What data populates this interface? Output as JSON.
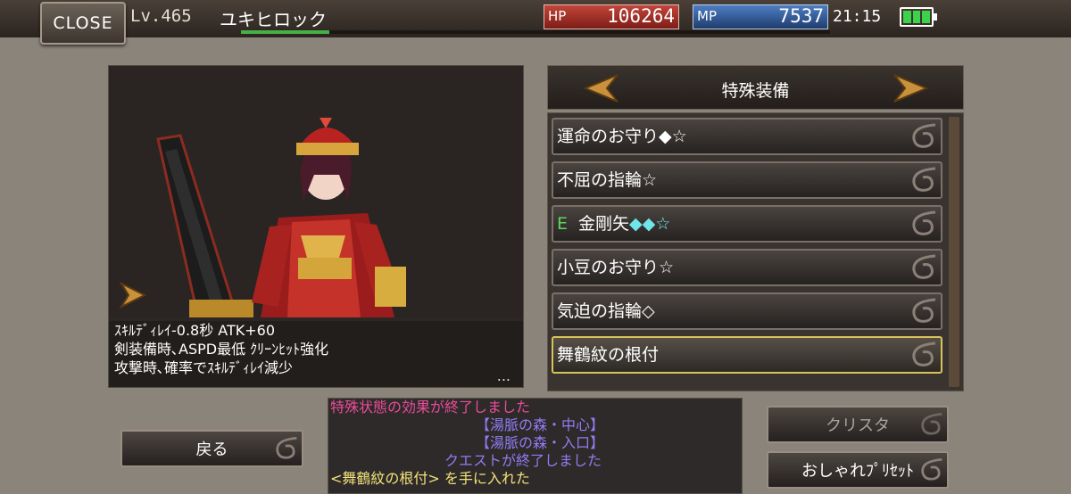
{
  "topbar": {
    "close_label": "CLOSE",
    "level": "Lv.465",
    "player_name": "ユキヒロック",
    "exp_fraction": 0.15,
    "hp_label": "HP",
    "hp_value": "106264",
    "mp_label": "MP",
    "mp_value": "7537",
    "clock": "21:15",
    "battery_level": 1.0
  },
  "character": {
    "desc_lines": [
      "ｽｷﾙﾃﾞｨﾚｲ-0.8秒 ATK+60",
      "剣装備時､ASPD最低 ｸﾘｰﾝﾋｯﾄ強化",
      "攻撃時､確率でｽｷﾙﾃﾞｨﾚｲ減少"
    ],
    "more": "..."
  },
  "equip": {
    "category": "特殊装備",
    "items": [
      {
        "equipped": false,
        "name": "運命のお守り",
        "suffix": "◆☆",
        "suffix_cyan": false
      },
      {
        "equipped": false,
        "name": "不屈の指輪",
        "suffix": "☆",
        "suffix_cyan": false
      },
      {
        "equipped": true,
        "eq_mark": "E",
        "name": "金剛矢",
        "suffix": "◆◆☆",
        "suffix_cyan": true
      },
      {
        "equipped": false,
        "name": "小豆のお守り",
        "suffix": "☆",
        "suffix_cyan": false
      },
      {
        "equipped": false,
        "name": "気迫の指輪",
        "suffix": "◇",
        "suffix_cyan": false
      },
      {
        "equipped": false,
        "name": "舞鶴紋の根付",
        "suffix": "",
        "suffix_cyan": false
      }
    ]
  },
  "log": {
    "line1": "特殊状態の効果が終了しました",
    "line2": "【湯脈の森・中心】",
    "line3": "【湯脈の森・入口】",
    "line4": "クエストが終了しました",
    "line5": "<舞鶴紋の根付> を手に入れた"
  },
  "buttons": {
    "back": "戻る",
    "crysta": "クリスタ",
    "fashion_preset": "おしゃれﾌﾟﾘｾｯﾄ"
  },
  "colors": {
    "hp": "#c3453a",
    "mp": "#4d7ec4",
    "selected_border": "#d7c35a",
    "equipped_mark": "#5bd85b",
    "log_system": "#ea4c9a",
    "log_quest": "#8f7df2",
    "log_item": "#f2e27a"
  }
}
